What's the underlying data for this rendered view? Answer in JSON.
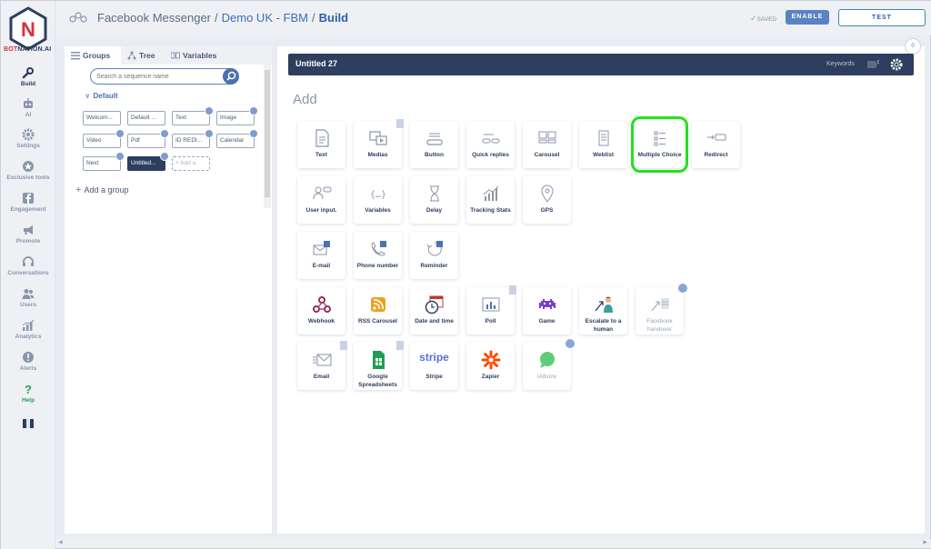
{
  "brand": {
    "logo_letter": "N",
    "name_prefix": "BOT",
    "name_suffix": "NATION.AI"
  },
  "nav": [
    {
      "id": "build",
      "label": "Build",
      "icon": "wrench-icon"
    },
    {
      "id": "ai",
      "label": "AI",
      "icon": "robot-icon"
    },
    {
      "id": "settings",
      "label": "Settings",
      "icon": "gear-icon"
    },
    {
      "id": "exclusive",
      "label": "Exclusive tools",
      "icon": "star-icon"
    },
    {
      "id": "engagement",
      "label": "Engagement",
      "icon": "facebook-icon"
    },
    {
      "id": "promote",
      "label": "Promote",
      "icon": "megaphone-icon"
    },
    {
      "id": "conversations",
      "label": "Conversations",
      "icon": "headset-icon"
    },
    {
      "id": "users",
      "label": "Users",
      "icon": "users-icon"
    },
    {
      "id": "analytics",
      "label": "Analytics",
      "icon": "chart-icon"
    },
    {
      "id": "alerts",
      "label": "Alerts",
      "icon": "alert-icon"
    },
    {
      "id": "help",
      "label": "Help",
      "icon": "question-icon"
    }
  ],
  "header": {
    "crumb1": "Facebook Messenger",
    "sep": "/",
    "crumb2": "Demo UK - FBM",
    "crumb3": "Build",
    "saved": "SAVED",
    "enable": "ENABLE",
    "test": "TEST"
  },
  "sidebar": {
    "tabs": [
      {
        "label": "Groups"
      },
      {
        "label": "Tree"
      },
      {
        "label": "Variables"
      }
    ],
    "search_placeholder": "Search a sequence name",
    "group_name": "Default",
    "sequences": [
      "Welcom...",
      "Default ...",
      "Text",
      "Image",
      "Video",
      "Pdf",
      "ID REDI...",
      "Calendar",
      "Next",
      "Untitled...",
      "Add a"
    ],
    "add_group": "Add a group"
  },
  "main": {
    "sequence_title": "Untitled 27",
    "keywords_label": "Keywords",
    "keywords_count": "0",
    "counter": "0",
    "add_title": "Add",
    "blocks": [
      {
        "label": "Text"
      },
      {
        "label": "Medias"
      },
      {
        "label": "Button"
      },
      {
        "label": "Quick replies"
      },
      {
        "label": "Carousel"
      },
      {
        "label": "Weblist"
      },
      {
        "label": "Multiple Choice"
      },
      {
        "label": "Redirect"
      },
      {
        "label": "User input."
      },
      {
        "label": "Variables"
      },
      {
        "label": "Delay"
      },
      {
        "label": "Tracking Stats"
      },
      {
        "label": "GPS"
      },
      {
        "label": "E-mail"
      },
      {
        "label": "Phone number"
      },
      {
        "label": "Reminder"
      },
      {
        "label": "Webhook"
      },
      {
        "label": "RSS Carousel"
      },
      {
        "label": "Date and time"
      },
      {
        "label": "Poll"
      },
      {
        "label": "Game"
      },
      {
        "label": "Escalate to a human"
      },
      {
        "label": "Facebook handover"
      },
      {
        "label": "Email"
      },
      {
        "label": "Google Spreadsheets"
      },
      {
        "label": "Stripe"
      },
      {
        "label": "Zapier"
      },
      {
        "label": "iAdvize"
      }
    ],
    "stripe_logo": "stripe"
  },
  "colors": {
    "navy": "#2d3e5e",
    "accent_blue": "#4c72b0",
    "highlight": "#25e01e",
    "help_green": "#2a9d4a"
  }
}
